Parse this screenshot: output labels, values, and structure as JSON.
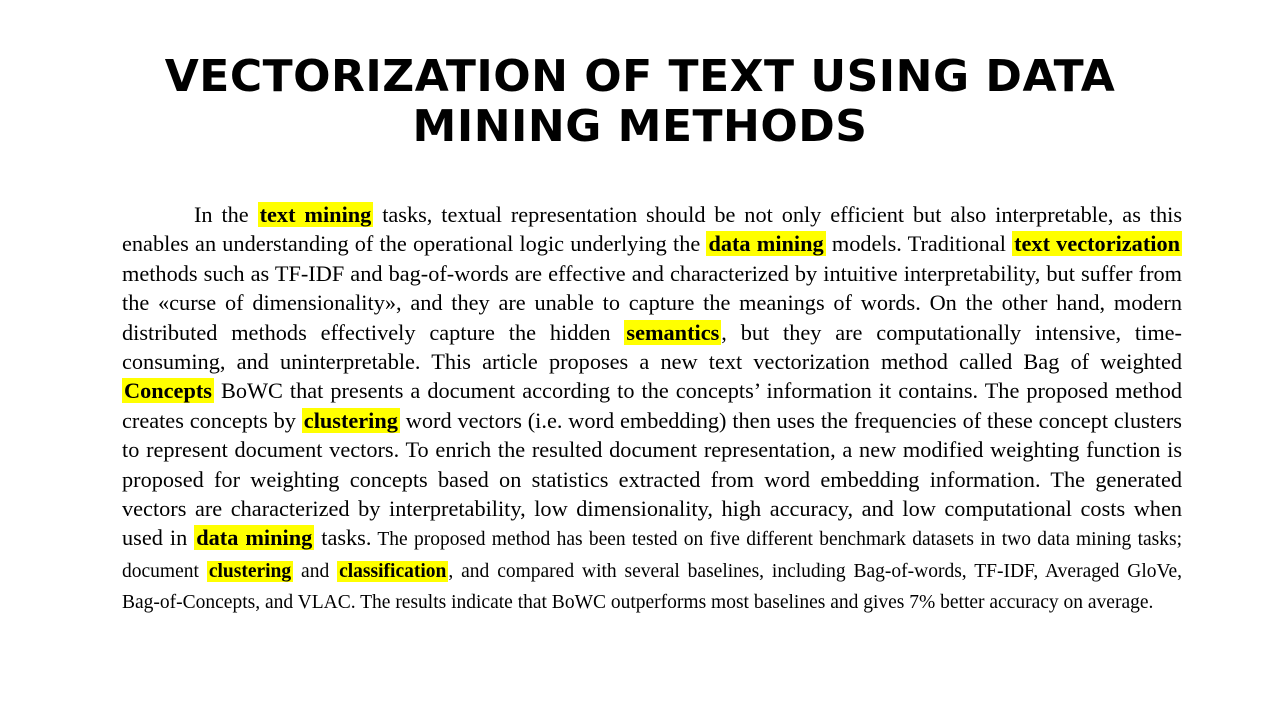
{
  "slide": {
    "title_line1": "VECTORIZATION OF TEXT USING DATA",
    "title_line2": "MINING METHODS",
    "highlight_color": "#ffff00",
    "paragraph": {
      "s1": "In the ",
      "h1": "text mining",
      "s2": " tasks, textual representation should be not only efficient but also interpretable, as this enables an understanding of the operational logic underlying the ",
      "h2": "data mining",
      "s3": " models. Traditional ",
      "h3": "text vectorization ",
      "s4": " methods such as TF-IDF and bag-of-words are effective and characterized by intuitive interpretability, but suffer from the «curse of dimensionality», and they are unable to capture the meanings of words. On the other hand, modern distributed methods effectively capture the hidden ",
      "h4": "semantics",
      "s5": ", but they are computationally intensive, time-consuming, and uninterpretable.  This article proposes a new text vectorization method called Bag of weighted ",
      "h5": "Concepts",
      "s6": " BoWC that presents a document according to the concepts’ information it contains. The proposed method creates concepts by ",
      "h6": "clustering",
      "s7": " word vectors (i.e. word embedding) then uses the frequencies of these concept clusters to represent document vectors. To enrich the resulted document representation, a new modified weighting function is proposed for weighting concepts based on statistics extracted from word embedding information. The generated vectors are characterized by interpretability, low dimensionality, high accuracy, and low computational costs when used in ",
      "h7": "data mining",
      "s8": " tasks.",
      "s9": " The proposed method has been tested on five different benchmark datasets in two data mining tasks; document ",
      "h8": "clustering",
      "s10": " and ",
      "h9": "classification",
      "s11": ", and compared with several baselines, including Bag-of-words, TF-IDF, Averaged GloVe, Bag-of-Concepts, and VLAC. The results indicate that BoWC outperforms most baselines and gives 7% better accuracy on average."
    }
  }
}
